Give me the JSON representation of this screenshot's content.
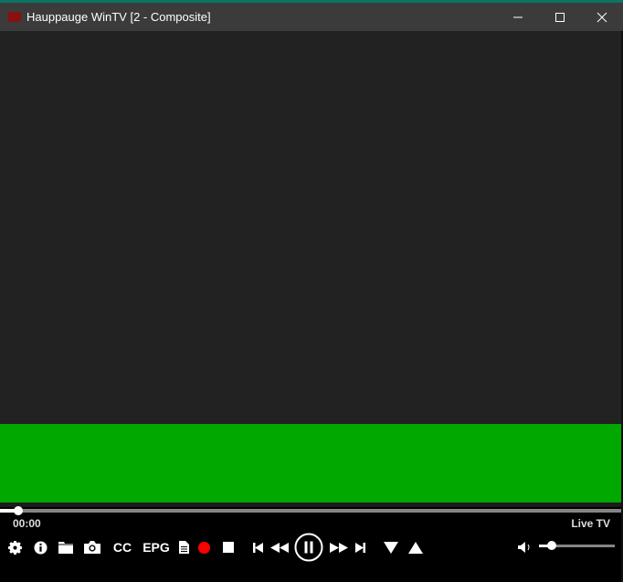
{
  "window": {
    "title": "Hauppauge WinTV [2 - Composite]"
  },
  "player": {
    "time": "00:00",
    "mode": "Live TV",
    "seek_progress": 0.03,
    "volume": 0.17
  },
  "controls": {
    "cc_label": "CC",
    "epg_label": "EPG"
  },
  "colors": {
    "accent": "#0b7563",
    "record": "#ff0000",
    "video_green": "#00a800"
  }
}
